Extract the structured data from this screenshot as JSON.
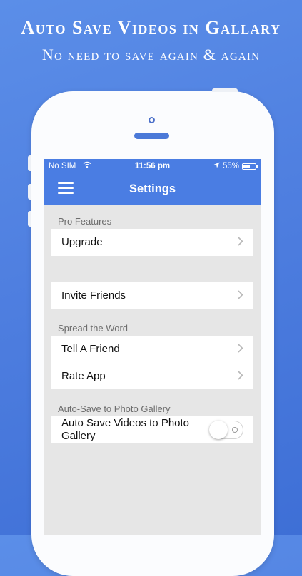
{
  "promo": {
    "title": "Auto Save Videos in Gallary",
    "subtitle": "No need to save again & again"
  },
  "status_bar": {
    "carrier": "No SIM",
    "time": "11:56 pm",
    "battery": "55%",
    "battery_level": 0.55
  },
  "navbar": {
    "title": "Settings",
    "menu_icon": "hamburger-icon"
  },
  "sections": {
    "pro": {
      "header": "Pro Features",
      "upgrade": "Upgrade"
    },
    "invite": {
      "invite_friends": "Invite Friends"
    },
    "spread": {
      "header": "Spread the Word",
      "tell_friend": "Tell A Friend",
      "rate_app": "Rate App"
    },
    "autosave": {
      "header": "Auto-Save to Photo Gallery",
      "toggle_label": "Auto Save Videos to Photo Gallery",
      "toggle_on": false
    }
  },
  "colors": {
    "background": "#4f7fe0",
    "navbar": "#4a7de3",
    "screen_bg": "#e6e6e6"
  }
}
